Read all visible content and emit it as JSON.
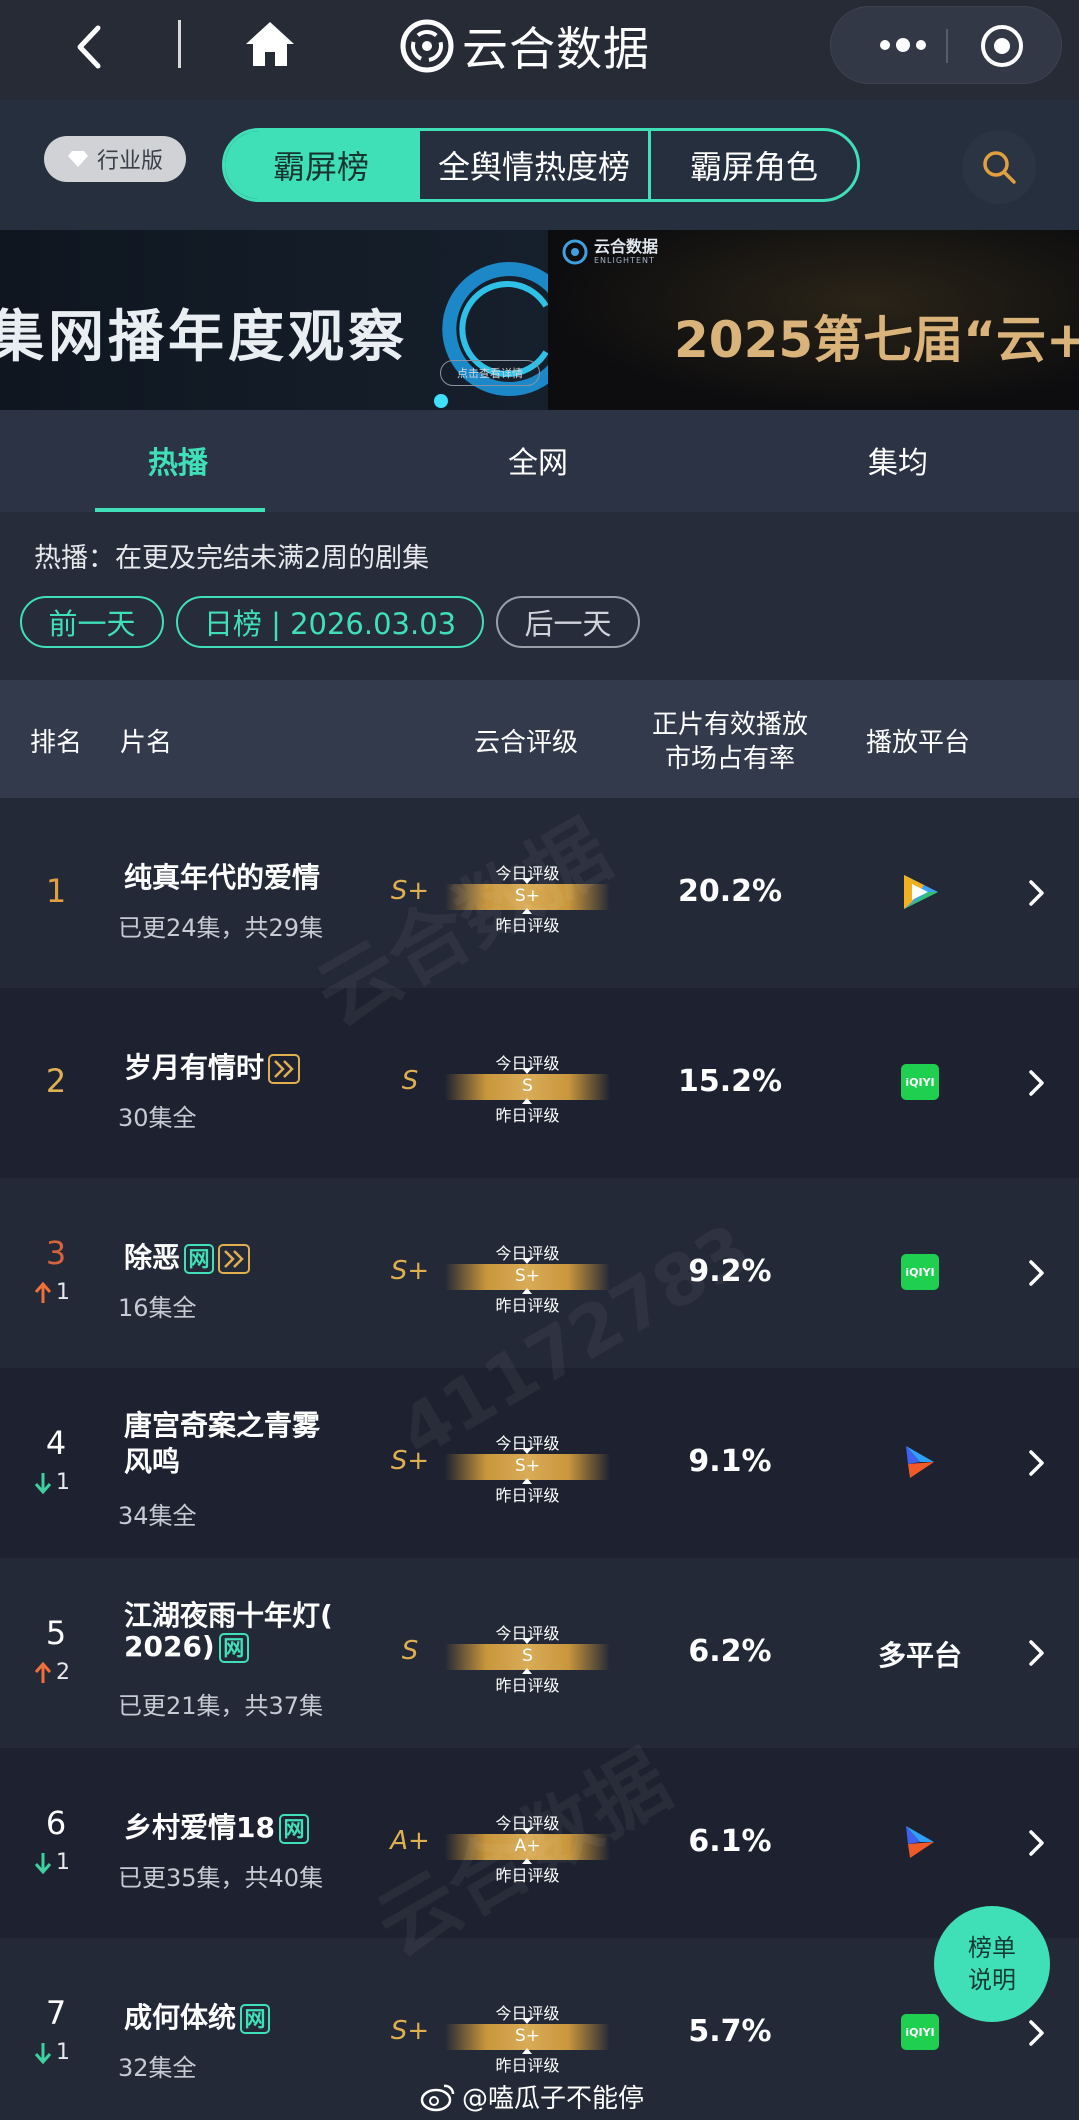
{
  "nav": {
    "title": "云合数据",
    "back_icon": "chevron-left-icon",
    "home_icon": "home-icon",
    "more_icon": "more-dots-icon",
    "target_icon": "target-icon"
  },
  "header": {
    "edition": "行业版",
    "tabs": [
      "霸屏榜",
      "全舆情热度榜",
      "霸屏角色"
    ],
    "active_tab": 0,
    "search_icon": "search-icon"
  },
  "banner": {
    "left_text": "集网播年度观察",
    "left_cta": "点击查看详情",
    "right_logo": "云合数据",
    "right_logo_sub": "ENLIGHTENT",
    "right_text": "2025第七届“云+"
  },
  "subtabs": [
    "热播",
    "全网",
    "集均"
  ],
  "info": {
    "desc": "热播：在更及完结未满2周的剧集",
    "prev": "前一天",
    "current": "日榜 | 2026.03.03",
    "next": "后一天"
  },
  "table": {
    "headers": {
      "rank": "排名",
      "name": "片名",
      "grade": "云合评级",
      "share_l1": "正片有效播放",
      "share_l2": "市场占有率",
      "platform": "播放平台"
    },
    "today_label": "今日评级",
    "yesterday_label": "昨日评级",
    "rows": [
      {
        "rank": "1",
        "change": "",
        "dir": "",
        "title": "纯真年代的爱情",
        "title2": "",
        "tags": [],
        "sub": "已更24集，共29集",
        "grade": "S+",
        "share": "20.2%",
        "platform": "tencent-video-icon",
        "platform_text": ""
      },
      {
        "rank": "2",
        "change": "",
        "dir": "",
        "title": "岁月有情时",
        "title2": "",
        "tags": [
          "play"
        ],
        "sub": "30集全",
        "grade": "S",
        "share": "15.2%",
        "platform": "iqiyi-icon",
        "platform_text": ""
      },
      {
        "rank": "3",
        "change": "1",
        "dir": "up",
        "title": "除恶",
        "title2": "",
        "tags": [
          "net",
          "play"
        ],
        "sub": "16集全",
        "grade": "S+",
        "share": "9.2%",
        "platform": "iqiyi-icon",
        "platform_text": ""
      },
      {
        "rank": "4",
        "change": "1",
        "dir": "down",
        "title": "唐宫奇案之青雾",
        "title2": "风鸣",
        "tags": [],
        "sub": "34集全",
        "grade": "S+",
        "share": "9.1%",
        "platform": "youku-icon",
        "platform_text": ""
      },
      {
        "rank": "5",
        "change": "2",
        "dir": "up",
        "title": "江湖夜雨十年灯(",
        "title2": "2026)",
        "tags": [
          "net"
        ],
        "sub": "已更21集，共37集",
        "grade": "S",
        "share": "6.2%",
        "platform": "",
        "platform_text": "多平台"
      },
      {
        "rank": "6",
        "change": "1",
        "dir": "down",
        "title": "乡村爱情18",
        "title2": "",
        "tags": [
          "net"
        ],
        "sub": "已更35集，共40集",
        "grade": "A+",
        "share": "6.1%",
        "platform": "youku-icon",
        "platform_text": ""
      },
      {
        "rank": "7",
        "change": "1",
        "dir": "down",
        "title": "成何体统",
        "title2": "",
        "tags": [
          "net"
        ],
        "sub": "32集全",
        "grade": "S+",
        "share": "5.7%",
        "platform": "iqiyi-icon",
        "platform_text": ""
      }
    ],
    "tag_net": "网",
    "iqiyi_text": "iQIYI"
  },
  "float_button": [
    "榜单",
    "说明"
  ],
  "watermark": {
    "brand": "云合数据",
    "brand_sub": "ENLIGHTENT",
    "number": "41172783"
  },
  "footer": {
    "weibo": "@嗑瓜子不能停"
  },
  "colors": {
    "accent": "#3fe0b8",
    "gold": "#e0b050",
    "up": "#f0703a",
    "down": "#3fd0a0",
    "background": "#242a38"
  }
}
